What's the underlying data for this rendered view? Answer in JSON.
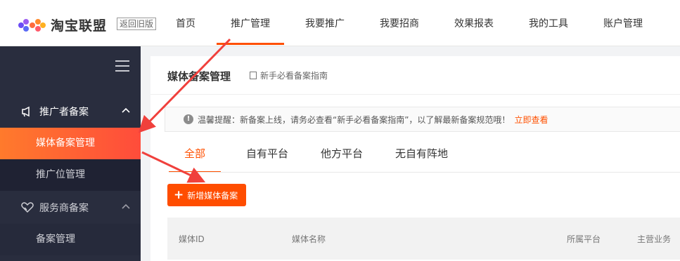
{
  "header": {
    "logo_text": "淘宝联盟",
    "old_version_label": "返回旧版",
    "nav": [
      {
        "label": "首页"
      },
      {
        "label": "推广管理"
      },
      {
        "label": "我要推广"
      },
      {
        "label": "我要招商"
      },
      {
        "label": "效果报表"
      },
      {
        "label": "我的工具"
      },
      {
        "label": "账户管理"
      }
    ],
    "active_nav": "推广管理"
  },
  "sidebar": {
    "groups": [
      {
        "label": "推广者备案",
        "icon": "megaphone-icon",
        "expanded": true
      },
      {
        "label": "服务商备案",
        "icon": "handshake-icon",
        "expanded": true
      }
    ],
    "items": [
      {
        "label": "媒体备案管理",
        "active": true
      },
      {
        "label": "推广位管理"
      },
      {
        "label": "备案管理"
      }
    ]
  },
  "main": {
    "title": "媒体备案管理",
    "guide_link": "新手必看备案指南",
    "notice": {
      "text": "温馨提醒：新备案上线，请务必查看“新手必看备案指南”，以了解最新备案规范哦！",
      "link": "立即查看"
    },
    "tabs": [
      {
        "label": "全部",
        "active": true
      },
      {
        "label": "自有平台"
      },
      {
        "label": "他方平台"
      },
      {
        "label": "无自有阵地"
      }
    ],
    "add_button": "新增媒体备案",
    "table_headers": [
      "媒体ID",
      "媒体名称",
      "所属平台",
      "主营业务"
    ]
  },
  "colors": {
    "accent": "#ff5000",
    "sidebar_bg": "#292d3e",
    "annotation_arrow": "#f0403c"
  }
}
